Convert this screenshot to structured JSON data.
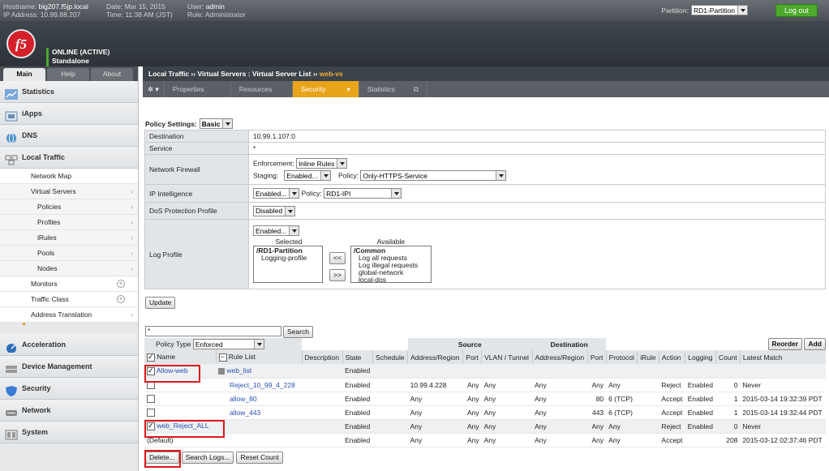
{
  "top": {
    "hostname_label": "Hostname:",
    "hostname": "big207.f5jp.local",
    "ip_label": "IP Address:",
    "ip": "10.99.88.207",
    "date_label": "Date:",
    "date": "Mar 15, 2015",
    "time_label": "Time:",
    "time": "11:38 AM (JST)",
    "user_label": "User:",
    "user": "admin",
    "role_label": "Role:",
    "role": "Administrator",
    "partition_label": "Partition:",
    "partition": "RD1-Partition",
    "logout": "Log out"
  },
  "header": {
    "logo": "f5",
    "status_line1": "ONLINE (ACTIVE)",
    "status_line2": "Standalone"
  },
  "sidebar": {
    "tabs": [
      "Main",
      "Help",
      "About"
    ],
    "sections": [
      "Statistics",
      "iApps",
      "DNS",
      "Local Traffic",
      "Acceleration",
      "Device Management",
      "Security",
      "Network",
      "System"
    ],
    "local_traffic_items": [
      "Network Map",
      "Virtual Servers",
      "Policies",
      "Profiles",
      "iRules",
      "Pools",
      "Nodes",
      "Monitors",
      "Traffic Class",
      "Address Translation"
    ]
  },
  "breadcrumb": {
    "path": "Local Traffic  ››  Virtual Servers : Virtual Server List",
    "sep": " ›› ",
    "current": "web-vs"
  },
  "subtabs": [
    "Properties",
    "Resources",
    "Security",
    "Statistics"
  ],
  "policy": {
    "settings_label": "Policy Settings:",
    "settings_value": "Basic",
    "destination_label": "Destination",
    "destination": "10.99.1.107:0",
    "service_label": "Service",
    "service": "*",
    "firewall_label": "Network Firewall",
    "enforcement_label": "Enforcement:",
    "enforcement": "Inline Rules",
    "staging_label": "Staging:",
    "staging": "Enabled...",
    "policy_label": "Policy:",
    "policy": "Only-HTTPS-Service",
    "ipi_label": "IP Intelligence",
    "ipi_state": "Enabled...",
    "ipi_policy_label": "Policy:",
    "ipi_policy": "RD1-IPI",
    "dos_label": "DoS Protection Profile",
    "dos": "Disabled",
    "log_label": "Log Profile",
    "log_state": "Enabled...",
    "selected_label": "Selected",
    "available_label": "Available",
    "selected_items": [
      "/RD1-Partition",
      "Logging-profile"
    ],
    "available_items": [
      "/Common",
      "Log all requests",
      "Log illegal requests",
      "global-network",
      "local-dos"
    ],
    "move_left": "<<",
    "move_right": ">>",
    "update": "Update"
  },
  "rules": {
    "search_value": "*",
    "search_button": "Search",
    "policy_type_label": "Policy Type",
    "policy_type": "Enforced",
    "reorder": "Reorder",
    "add": "Add",
    "source_group": "Source",
    "dest_group": "Destination",
    "columns": [
      "Name",
      "Rule List",
      "Description",
      "State",
      "Schedule",
      "Address/Region",
      "Port",
      "VLAN / Tunnel",
      "Address/Region",
      "Port",
      "Protocol",
      "iRule",
      "Action",
      "Logging",
      "Count",
      "Latest Match"
    ],
    "rows": [
      {
        "name": "Allow-web",
        "rulelist": "web_list",
        "state": "Enabled",
        "saddr": "",
        "sport": "",
        "vlan": "",
        "daddr": "",
        "dport": "",
        "proto": "",
        "action": "",
        "logging": "",
        "count": "",
        "latest": ""
      },
      {
        "name": "",
        "rulelist": "Reject_10_99_4_228",
        "state": "Enabled",
        "saddr": "10.99.4.228",
        "sport": "Any",
        "vlan": "Any",
        "daddr": "Any",
        "dport": "Any",
        "proto": "Any",
        "action": "Reject",
        "logging": "Enabled",
        "count": "0",
        "latest": "Never"
      },
      {
        "name": "",
        "rulelist": "allow_80",
        "state": "Enabled",
        "saddr": "Any",
        "sport": "Any",
        "vlan": "Any",
        "daddr": "Any",
        "dport": "80",
        "proto": "6 (TCP)",
        "action": "Accept",
        "logging": "Enabled",
        "count": "1",
        "latest": "2015-03-14 19:32:39 PDT"
      },
      {
        "name": "",
        "rulelist": "allow_443",
        "state": "Enabled",
        "saddr": "Any",
        "sport": "Any",
        "vlan": "Any",
        "daddr": "Any",
        "dport": "443",
        "proto": "6 (TCP)",
        "action": "Accept",
        "logging": "Enabled",
        "count": "1",
        "latest": "2015-03-14 19:32:44 PDT"
      },
      {
        "name": "web_Reject_ALL",
        "rulelist": "",
        "state": "Enabled",
        "saddr": "Any",
        "sport": "Any",
        "vlan": "Any",
        "daddr": "Any",
        "dport": "Any",
        "proto": "Any",
        "action": "Reject",
        "logging": "Enabled",
        "count": "0",
        "latest": "Never"
      },
      {
        "name": "(Default)",
        "rulelist": "",
        "state": "Enabled",
        "saddr": "Any",
        "sport": "Any",
        "vlan": "Any",
        "daddr": "Any",
        "dport": "Any",
        "proto": "Any",
        "action": "Accept",
        "logging": "",
        "count": "208",
        "latest": "2015-03-12 02:37:46 PDT"
      }
    ],
    "delete": "Delete...",
    "search_logs": "Search Logs...",
    "reset_count": "Reset Count"
  },
  "colors": {
    "accent": "#e8a41a",
    "online": "#4caa2c",
    "highlight": "#e0161a",
    "link": "#2a4fb2"
  }
}
